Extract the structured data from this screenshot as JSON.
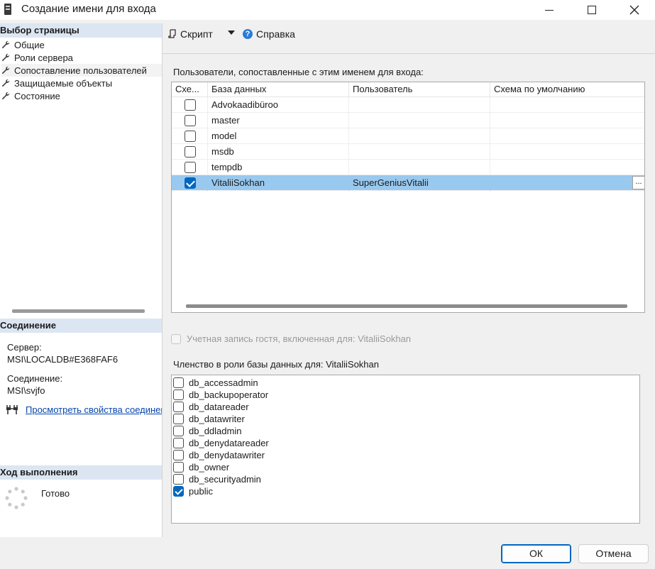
{
  "window": {
    "title": "Создание имени для входа",
    "icon": "server-icon"
  },
  "left": {
    "select_page_header": "Выбор страницы",
    "pages": [
      {
        "label": "Общие",
        "icon": "wrench-icon",
        "selected": false
      },
      {
        "label": "Роли сервера",
        "icon": "wrench-icon",
        "selected": false
      },
      {
        "label": "Сопоставление пользователей",
        "icon": "wrench-icon",
        "selected": true
      },
      {
        "label": "Защищаемые объекты",
        "icon": "wrench-icon",
        "selected": false
      },
      {
        "label": "Состояние",
        "icon": "wrench-icon",
        "selected": false
      }
    ],
    "connection_header": "Соединение",
    "server_label": "Сервер:",
    "server_value": "MSI\\LOCALDB#E368FAF6",
    "connection_label": "Соединение:",
    "connection_value": "MSI\\svjfo",
    "view_properties_link": "Просмотреть свойства соединения",
    "progress_header": "Ход выполнения",
    "progress_status": "Готово"
  },
  "toolbar": {
    "script_label": "Скрипт",
    "help_label": "Справка"
  },
  "main": {
    "users_section_label": "Пользователи, сопоставленные с этим именем для входа:",
    "grid_headers": [
      "Схе...",
      "База данных",
      "Пользователь",
      "Схема по умолчанию"
    ],
    "rows": [
      {
        "checked": false,
        "database": "Advokaadibüroo",
        "user": "",
        "schema": "",
        "selected": false
      },
      {
        "checked": false,
        "database": "master",
        "user": "",
        "schema": "",
        "selected": false
      },
      {
        "checked": false,
        "database": "model",
        "user": "",
        "schema": "",
        "selected": false
      },
      {
        "checked": false,
        "database": "msdb",
        "user": "",
        "schema": "",
        "selected": false
      },
      {
        "checked": false,
        "database": "tempdb",
        "user": "",
        "schema": "",
        "selected": false
      },
      {
        "checked": true,
        "database": "VitaliiSokhan",
        "user": "SuperGeniusVitalii",
        "schema": "",
        "selected": true
      }
    ],
    "ellipsis_button": "...",
    "guest_account_label": "Учетная запись гостя, включенная для: VitaliiSokhan",
    "roles_section_label": "Членство в роли базы данных для: VitaliiSokhan",
    "roles": [
      {
        "name": "db_accessadmin",
        "checked": false
      },
      {
        "name": "db_backupoperator",
        "checked": false
      },
      {
        "name": "db_datareader",
        "checked": false
      },
      {
        "name": "db_datawriter",
        "checked": false
      },
      {
        "name": "db_ddladmin",
        "checked": false
      },
      {
        "name": "db_denydatareader",
        "checked": false
      },
      {
        "name": "db_denydatawriter",
        "checked": false
      },
      {
        "name": "db_owner",
        "checked": false
      },
      {
        "name": "db_securityadmin",
        "checked": false
      },
      {
        "name": "public",
        "checked": true
      }
    ]
  },
  "buttons": {
    "ok": "ОК",
    "cancel": "Отмена"
  },
  "colors": {
    "accent": "#0067c0",
    "selected_row": "#99c9ef",
    "section_header": "#dce6f2",
    "link": "#0645ad"
  }
}
